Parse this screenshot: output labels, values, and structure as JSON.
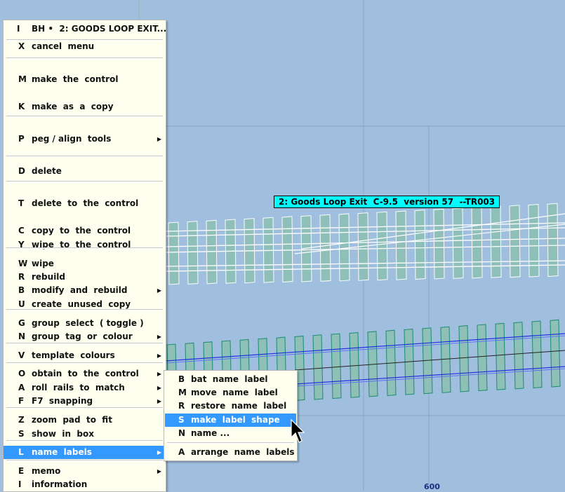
{
  "canvas": {
    "background": "#a0bfdf",
    "axis_label": "600",
    "template_label": "2: Goods Loop Exit  C-9.5  version 57  --TR003"
  },
  "main_menu": {
    "items": [
      {
        "key": "I",
        "label": "BH •  2: GOODS LOOP EXIT...",
        "underline": "",
        "submenu": false
      },
      {
        "key": "X",
        "label": "cancel  menu",
        "underline": "key",
        "submenu": false
      },
      {
        "key": "M",
        "label": "make  the  control",
        "underline": "m",
        "submenu": false
      },
      {
        "key": "K",
        "label": "make  as  a  copy",
        "underline": "k",
        "submenu": false
      },
      {
        "key": "P",
        "label": "peg / align  tools",
        "underline": "p",
        "submenu": true
      },
      {
        "key": "D",
        "label": "delete",
        "underline": "d",
        "submenu": false
      },
      {
        "key": "T",
        "label": "delete  to  the  control",
        "underline": "t",
        "submenu": false
      },
      {
        "key": "C",
        "label": "copy  to  the  control",
        "underline": "c",
        "submenu": false
      },
      {
        "key": "Y",
        "label": "wipe  to  the  control",
        "underline": "key",
        "submenu": false
      },
      {
        "key": "W",
        "label": "wipe",
        "underline": "w",
        "submenu": false
      },
      {
        "key": "R",
        "label": "rebuild",
        "underline": "r",
        "submenu": false
      },
      {
        "key": "B",
        "label": "modify  and  rebuild",
        "underline": "b",
        "submenu": true
      },
      {
        "key": "U",
        "label": "create  unused  copy",
        "underline": "u",
        "submenu": false
      },
      {
        "key": "G",
        "label": "group  select  ( toggle )",
        "underline": "",
        "submenu": false
      },
      {
        "key": "N",
        "label": "group  tag  or  colour",
        "underline": "key",
        "submenu": true
      },
      {
        "key": "V",
        "label": "template  colours",
        "underline": "key",
        "submenu": true
      },
      {
        "key": "O",
        "label": "obtain  to  the  control",
        "underline": "o",
        "submenu": true
      },
      {
        "key": "A",
        "label": "roll  rails  to  match",
        "underline": "a",
        "submenu": true
      },
      {
        "key": "F",
        "label": "F7  snapping",
        "underline": "f",
        "submenu": true
      },
      {
        "key": "Z",
        "label": "zoom  pad  to  fit",
        "underline": "z",
        "submenu": false
      },
      {
        "key": "S",
        "label": "show  in  box",
        "underline": "s",
        "submenu": false
      },
      {
        "key": "L",
        "label": "name  labels",
        "underline": "l",
        "submenu": true,
        "highlighted": true
      },
      {
        "key": "E",
        "label": "memo",
        "underline": "e",
        "submenu": true
      },
      {
        "key": "I",
        "label": "information",
        "underline": "i",
        "submenu": false
      }
    ]
  },
  "sub_menu": {
    "items": [
      {
        "key": "B",
        "label": "bat  name  label"
      },
      {
        "key": "M",
        "label": "move  name  label"
      },
      {
        "key": "R",
        "label": "restore  name  label"
      },
      {
        "key": "S",
        "label": "make  label  shape",
        "highlighted": true
      },
      {
        "key": "N",
        "label": "name ..."
      },
      {
        "key": "A",
        "label": "arrange  name  labels"
      }
    ]
  },
  "colors": {
    "menu_bg": "#fffff0",
    "highlight": "#3399ff",
    "label_bg": "#00ffff",
    "sleeper_fill": "#8fc0b8",
    "rail_blue": "#2030e0",
    "sleeper_outline_green": "#1e8a6e"
  }
}
